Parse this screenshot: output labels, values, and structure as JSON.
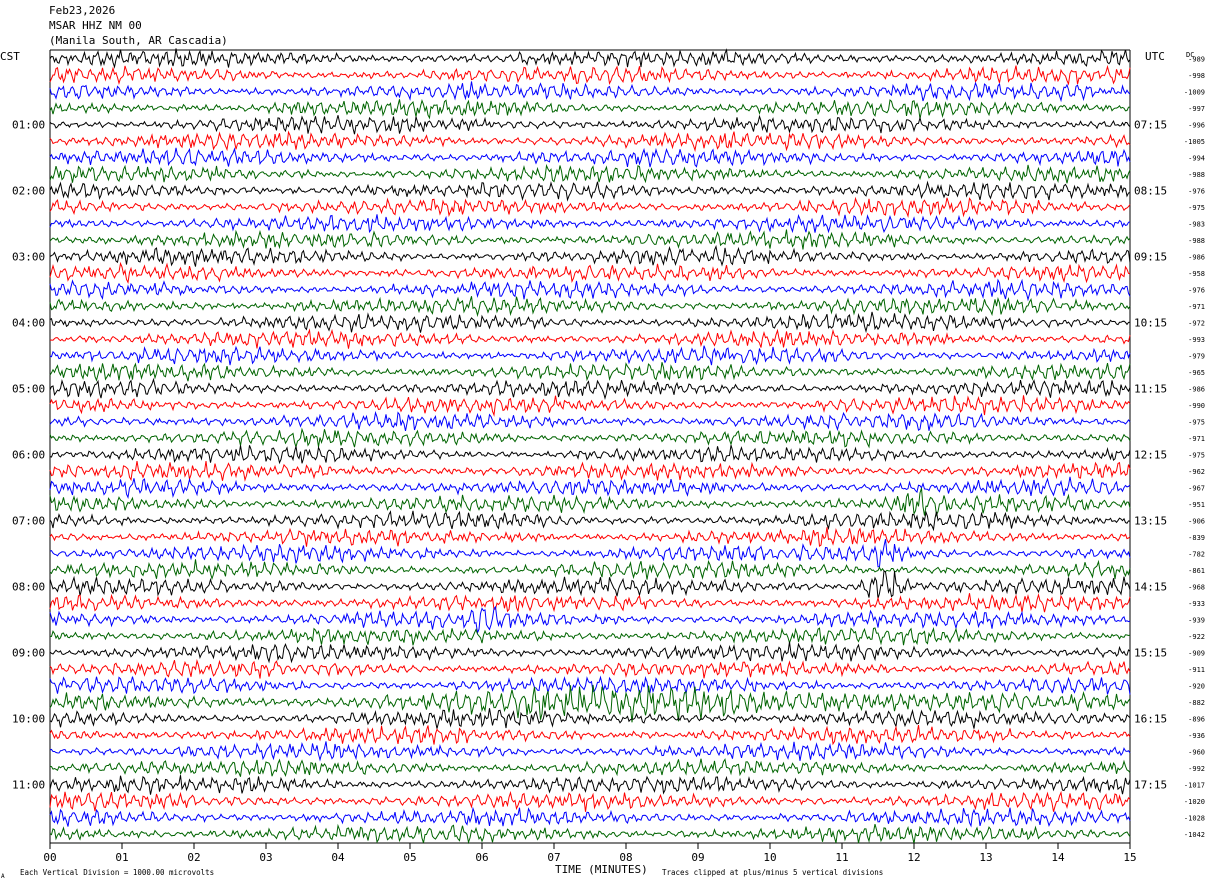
{
  "header": {
    "date": "Feb23,2026",
    "station": "MSAR HHZ NM 00",
    "location": "(Manila South, AR Cascadia)"
  },
  "left_tz": "CST",
  "right_tz": "UTC",
  "dc_label": "DC",
  "footer": {
    "scale_note": "Each Vertical Division = 1000.00 microvolts",
    "clip_note": "Traces clipped at plus/minus 5 vertical divisions",
    "corner_mark": "A"
  },
  "colors": [
    "#000000",
    "#ff0000",
    "#0000ff",
    "#006400"
  ],
  "chart_data": {
    "type": "line",
    "xlabel": "TIME (MINUTES)",
    "x_ticks": [
      "00",
      "01",
      "02",
      "03",
      "04",
      "05",
      "06",
      "07",
      "08",
      "09",
      "10",
      "11",
      "12",
      "13",
      "14",
      "15"
    ],
    "xlim": [
      0,
      15
    ],
    "traces_per_hour": 4,
    "left_time_labels": [
      "01:00",
      "02:00",
      "03:00",
      "04:00",
      "05:00",
      "06:00",
      "07:00",
      "08:00",
      "09:00",
      "10:00",
      "11:00"
    ],
    "right_time_labels": [
      "07:15",
      "08:15",
      "09:15",
      "10:15",
      "11:15",
      "12:15",
      "13:15",
      "14:15",
      "15:15",
      "16:15",
      "17:15"
    ],
    "dc_offsets": [
      -989,
      -998,
      -1009,
      -997,
      -996,
      -1005,
      -994,
      -988,
      -976,
      -975,
      -983,
      -988,
      -986,
      -958,
      -976,
      -971,
      -972,
      -993,
      -979,
      -965,
      -986,
      -990,
      -975,
      -971,
      -975,
      -962,
      -967,
      -951,
      -906,
      -839,
      -782,
      -861,
      -968,
      -933,
      -939,
      -922,
      -909,
      -911,
      -920,
      -882,
      -896,
      -936,
      -960,
      -992,
      -1017,
      -1020,
      -1028,
      -1042
    ],
    "events": [
      {
        "trace": 27,
        "minute": 12.1,
        "note": "small burst"
      },
      {
        "trace": 30,
        "minute": 11.6,
        "note": "burst"
      },
      {
        "trace": 32,
        "minute": 11.6,
        "note": "large burst"
      },
      {
        "trace": 34,
        "minute": 6.05,
        "note": "burst"
      },
      {
        "trace": 39,
        "minute": 8.5,
        "note": "extended high amplitude"
      }
    ]
  }
}
